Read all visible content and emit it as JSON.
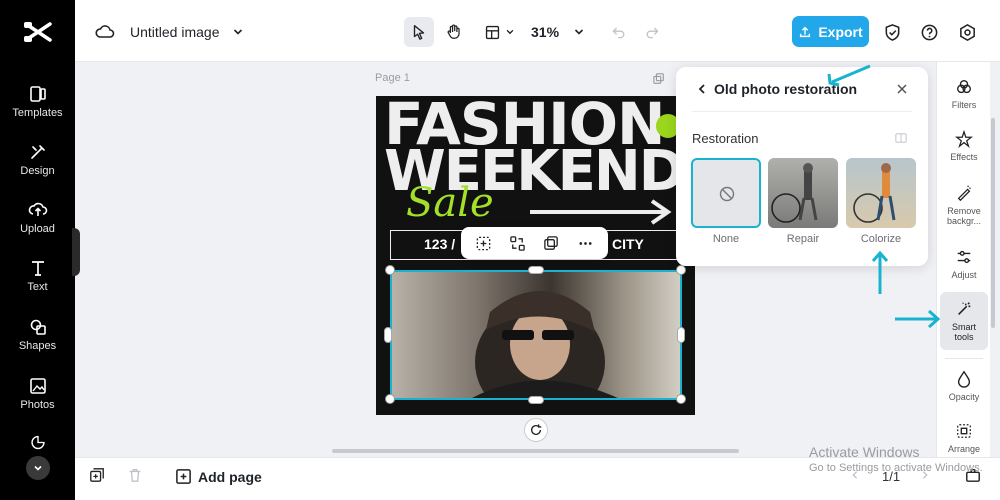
{
  "app": {
    "title": "Untitled image",
    "zoom": "31%",
    "export_label": "Export"
  },
  "rail": {
    "items": [
      {
        "label": "Templates",
        "icon": "templates-icon"
      },
      {
        "label": "Design",
        "icon": "design-icon"
      },
      {
        "label": "Upload",
        "icon": "upload-icon"
      },
      {
        "label": "Text",
        "icon": "text-icon"
      },
      {
        "label": "Shapes",
        "icon": "shapes-icon"
      },
      {
        "label": "Photos",
        "icon": "photos-icon"
      }
    ]
  },
  "canvas": {
    "page_label": "Page 1",
    "design": {
      "line1": "FASHION",
      "line2": "WEEKEND",
      "script": "Sale",
      "address_left": "123 /",
      "address_right": "CITY"
    }
  },
  "panel": {
    "title": "Old photo restoration",
    "section": "Restoration",
    "options": [
      {
        "label": "None",
        "selected": true
      },
      {
        "label": "Repair",
        "selected": false
      },
      {
        "label": "Colorize",
        "selected": false
      }
    ]
  },
  "right_sidebar": {
    "items": [
      {
        "label": "Filters"
      },
      {
        "label": "Effects"
      },
      {
        "label": "Remove backgr..."
      },
      {
        "label": "Adjust"
      },
      {
        "label": "Smart tools",
        "active": true
      },
      {
        "label": "Opacity"
      },
      {
        "label": "Arrange"
      }
    ]
  },
  "bottom": {
    "add_page": "Add page",
    "page_count": "1/1"
  },
  "watermark": {
    "line1": "Activate Windows",
    "line2": "Go to Settings to activate Windows."
  },
  "colors": {
    "accent": "#21a7ea",
    "annotation": "#17b3cf",
    "design_green": "#9bd51d"
  }
}
